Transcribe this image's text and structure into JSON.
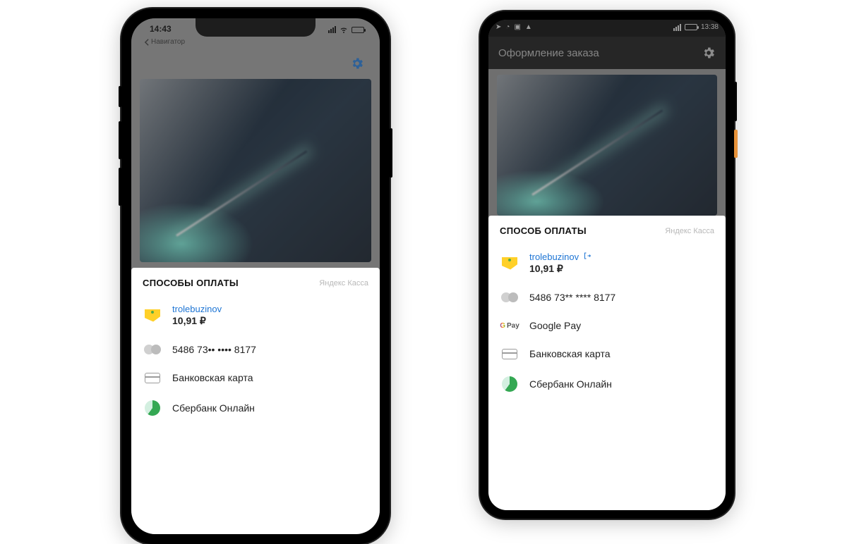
{
  "ios": {
    "status": {
      "time": "14:43",
      "back_label": "Навигатор"
    },
    "sheet": {
      "title": "СПОСОБЫ ОПЛАТЫ",
      "brand": "Яндекс Касса",
      "wallet_user": "trolebuzinov",
      "wallet_amount": "10,91 ₽",
      "card_masked": "5486 73•• •••• 8177",
      "bank_card_label": "Банковская карта",
      "sber_label": "Сбербанк Онлайн"
    }
  },
  "android": {
    "status": {
      "time": "13:38"
    },
    "appbar_title": "Оформление заказа",
    "sheet": {
      "title": "СПОСОБ ОПЛАТЫ",
      "brand": "Яндекс Касса",
      "wallet_user": "trolebuzinov",
      "wallet_amount": "10,91 ₽",
      "card_masked": "5486 73** **** 8177",
      "gpay_label": "Google Pay",
      "bank_card_label": "Банковская карта",
      "sber_label": "Сбербанк Онлайн"
    }
  }
}
